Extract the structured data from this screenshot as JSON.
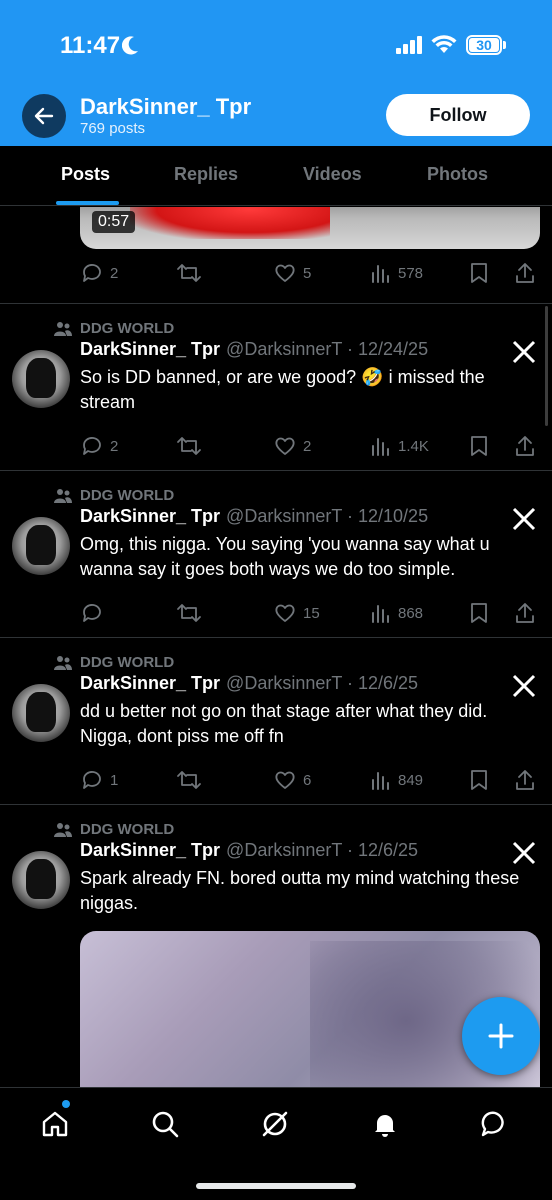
{
  "status_bar": {
    "time": "11:47",
    "battery": "30"
  },
  "header": {
    "profile_name": "DarkSinner_ Tpr",
    "post_count": "769 posts",
    "follow_label": "Follow"
  },
  "tabs": [
    "Posts",
    "Replies",
    "Videos",
    "Photos"
  ],
  "active_tab": "Posts",
  "top_media": {
    "duration": "0:57"
  },
  "top_actions": {
    "replies": "2",
    "reposts": "",
    "likes": "5",
    "views": "578"
  },
  "posts": [
    {
      "pinned_label": "DDG WORLD",
      "display_name": "DarkSinner_ Tpr",
      "handle_date": "@DarksinnerT · 12/24/25",
      "text": "So is DD banned, or are we good? 🤣 i missed the stream",
      "replies": "2",
      "reposts": "",
      "likes": "2",
      "views": "1.4K"
    },
    {
      "pinned_label": "DDG WORLD",
      "display_name": "DarkSinner_ Tpr",
      "handle_date": "@DarksinnerT · 12/10/25",
      "text": "Omg, this nigga. You saying 'you wanna say what u wanna say it goes both ways we do too simple.",
      "replies": "",
      "reposts": "",
      "likes": "15",
      "views": "868"
    },
    {
      "pinned_label": "DDG WORLD",
      "display_name": "DarkSinner_ Tpr",
      "handle_date": "@DarksinnerT · 12/6/25",
      "text": "dd u better not go on that stage after what they did. Nigga, dont piss me off fn",
      "replies": "1",
      "reposts": "",
      "likes": "6",
      "views": "849"
    },
    {
      "pinned_label": "DDG WORLD",
      "display_name": "DarkSinner_ Tpr",
      "handle_date": "@DarksinnerT · 12/6/25",
      "text": "Spark already FN. bored outta my mind watching these niggas."
    }
  ],
  "colors": {
    "header_blue": "#2196f3",
    "accent": "#1d9bf0",
    "muted": "#71767b",
    "background": "#000000"
  },
  "icons": [
    "back-arrow-icon",
    "reply-icon",
    "repost-icon",
    "like-icon",
    "views-icon",
    "bookmark-icon",
    "share-icon",
    "x-logo-icon",
    "community-icon",
    "compose-icon",
    "home-icon",
    "search-icon",
    "grok-icon",
    "notifications-icon",
    "messages-icon"
  ]
}
